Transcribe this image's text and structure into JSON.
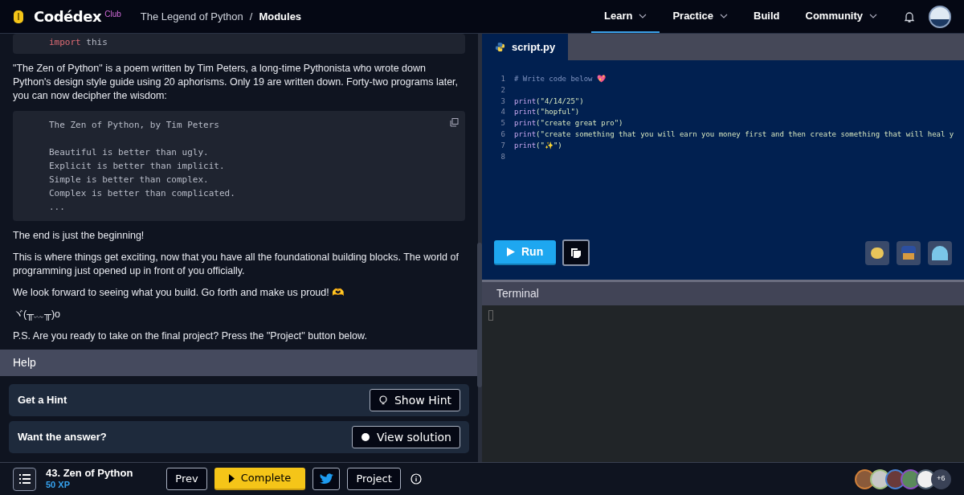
{
  "header": {
    "logo": "Codédex",
    "logo_badge": "Club",
    "breadcrumb_separator": "/",
    "breadcrumb": [
      {
        "label": "The Legend of Python",
        "current": false
      },
      {
        "label": "Modules",
        "current": true
      }
    ],
    "nav": [
      {
        "label": "Learn",
        "dropdown": true,
        "selected": true
      },
      {
        "label": "Practice",
        "dropdown": true,
        "selected": false
      },
      {
        "label": "Build",
        "dropdown": false,
        "selected": false
      },
      {
        "label": "Community",
        "dropdown": true,
        "selected": false
      }
    ]
  },
  "lesson": {
    "blocks": [
      {
        "kind": "import",
        "keyword": "import",
        "name": "this"
      },
      {
        "kind": "text",
        "text": "\"The Zen of Python\" is a poem written by Tim Peters, a long-time Pythonista who wrote down Python's design style guide using 20 aphorisms. Only 19 are written down. Forty-two programs later, you can now decipher the wisdom:"
      },
      {
        "kind": "code",
        "heading": "The Zen of Python, by Tim Peters",
        "lines": [
          "Beautiful is better than ugly.",
          "Explicit is better than implicit.",
          "Simple is better than complex.",
          "Complex is better than complicated.",
          "..."
        ]
      },
      {
        "kind": "text",
        "text": "The end is just the beginning!"
      },
      {
        "kind": "text",
        "text": "This is where things get exciting, now that you have all the foundational building blocks. The world of programming just opened up in front of you officially."
      },
      {
        "kind": "text",
        "text": "We look forward to seeing what you build. Go forth and make us proud! 🫶"
      },
      {
        "kind": "text",
        "text": "ヾ(╥﹏╥)o"
      },
      {
        "kind": "text",
        "text": "P.S. Are you ready to take on the final project? Press the \"Project\" button below."
      }
    ],
    "help": {
      "title": "Help",
      "cards": [
        {
          "label": "Get a Hint",
          "button": "Show Hint"
        },
        {
          "label": "Want the answer?",
          "button": "View solution"
        }
      ]
    }
  },
  "editor": {
    "tab": "script.py",
    "lines": [
      {
        "number": "1",
        "comment": "# Write code below 💖"
      },
      {
        "number": "2"
      },
      {
        "number": "3",
        "function": "print",
        "args": "(\"4/14/25\")"
      },
      {
        "number": "4",
        "function": "print",
        "args": "(\"hopful\")"
      },
      {
        "number": "5",
        "function": "print",
        "args": "(\"create great pro\")"
      },
      {
        "number": "6",
        "function": "print",
        "args": "(\"create something that you will earn you money first and then create something that will heal y"
      },
      {
        "number": "7",
        "function": "print",
        "args": "(\"✨\")"
      },
      {
        "number": "8"
      }
    ],
    "run": "Run",
    "terminal": "Terminal"
  },
  "footer": {
    "title": "43. Zen of Python",
    "xp": "50 XP",
    "buttons": [
      {
        "label": "Prev",
        "kind": "dark"
      },
      {
        "label": "Complete",
        "kind": "primary"
      },
      {
        "kind": "twitter"
      },
      {
        "label": "Project",
        "kind": "dark"
      }
    ],
    "more_users": "+6"
  }
}
